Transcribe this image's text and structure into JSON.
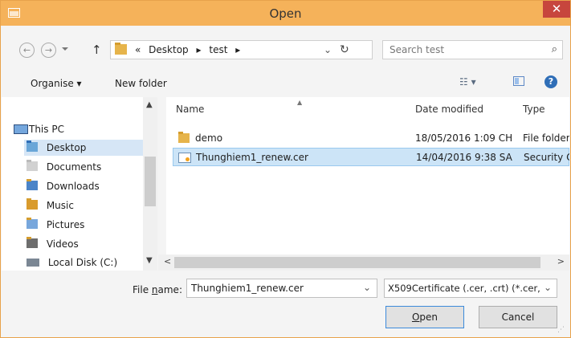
{
  "window": {
    "title": "Open",
    "close_glyph": "✕"
  },
  "nav": {
    "back_glyph": "←",
    "forward_glyph": "→",
    "up_glyph": "↑",
    "chevrons": "«",
    "path": [
      "Desktop",
      "test"
    ],
    "path_sep": "▸",
    "refresh_glyph": "↻",
    "dropdown_glyph": "⌄"
  },
  "search": {
    "placeholder": "Search test",
    "icon_glyph": "⌕"
  },
  "toolbar": {
    "organise": "Organise ▾",
    "new_folder": "New folder",
    "view_glyph": "☷ ▾",
    "help_glyph": "?"
  },
  "tree": {
    "items": [
      {
        "label": "This PC"
      },
      {
        "label": "Desktop"
      },
      {
        "label": "Documents"
      },
      {
        "label": "Downloads"
      },
      {
        "label": "Music"
      },
      {
        "label": "Pictures"
      },
      {
        "label": "Videos"
      },
      {
        "label": "Local Disk (C:)"
      }
    ],
    "scroll_up_glyph": "▲",
    "scroll_down_glyph": "▼"
  },
  "list": {
    "columns": {
      "name": "Name",
      "date": "Date modified",
      "type": "Type"
    },
    "sort_glyph": "▲",
    "files": [
      {
        "name": "demo",
        "date": "18/05/2016 1:09 CH",
        "type": "File folder"
      },
      {
        "name": "Thunghiem1_renew.cer",
        "date": "14/04/2016 9:38 SA",
        "type": "Security C"
      }
    ],
    "hscroll_left": "<",
    "hscroll_right": ">"
  },
  "footer": {
    "file_name_label_prefix": "File ",
    "file_name_label_underlined": "n",
    "file_name_label_suffix": "ame:",
    "file_name_value": "Thunghiem1_renew.cer",
    "file_type_value": "X509Certificate (.cer, .crt) (*.cer,",
    "open_underlined": "O",
    "open_rest": "pen",
    "cancel": "Cancel",
    "drop_glyph": "⌄",
    "grip_glyph": "⋰"
  }
}
